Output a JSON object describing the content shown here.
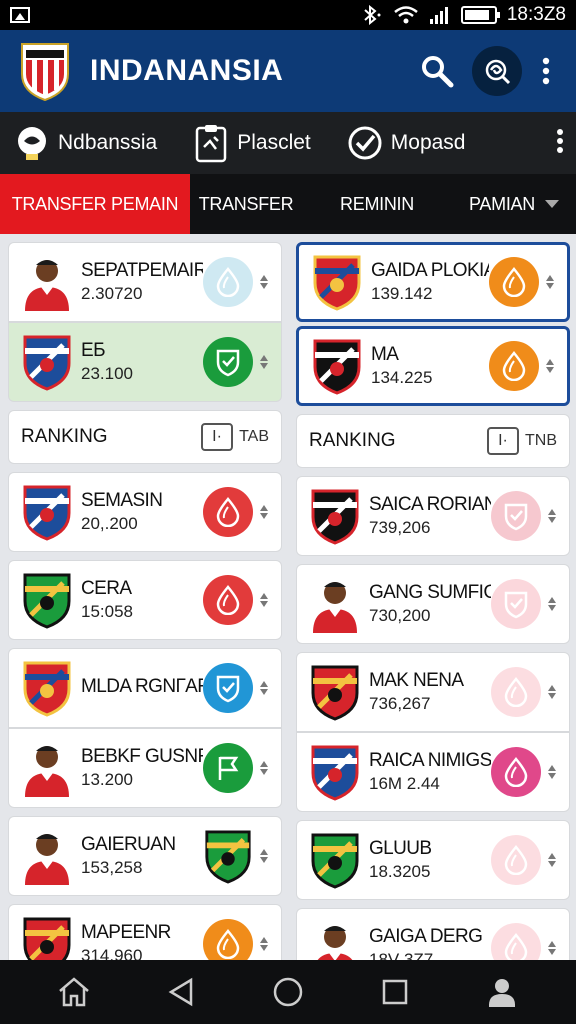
{
  "status_bar": {
    "time": "18:3Z8",
    "battery_level": 0.85
  },
  "header": {
    "title": "INDANANSIA"
  },
  "sub_nav": {
    "items": [
      {
        "label": "Ndbanssia",
        "icon": "badge-icon"
      },
      {
        "label": "Plasclet",
        "icon": "clipboard-icon"
      },
      {
        "label": "Mopasd",
        "icon": "check-circle-icon"
      }
    ]
  },
  "tabs": [
    {
      "label": "TRANSFER PEMAIN",
      "active": true
    },
    {
      "label": "TRANSFER"
    },
    {
      "label": "REMININ"
    },
    {
      "label": "PAMIAN"
    }
  ],
  "left_column": {
    "cards_top": [
      {
        "name": "SEPATPEMAIR",
        "value": "2.30720",
        "thumb": "player-photo",
        "badge_color": "#cfe9f2",
        "badge_icon": "drop-icon"
      },
      {
        "name": "EБ",
        "value": "23.100",
        "thumb": "club-crest",
        "badge_color": "#1a9c3c",
        "badge_icon": "shield-icon"
      }
    ],
    "ranking": {
      "label": "RANKING",
      "box": "I·",
      "tag": "TAB"
    },
    "cards_bottom": [
      {
        "name": "SEMASIN",
        "value": "20,.200",
        "thumb": "club-crest",
        "badge_color": "#e23b3b",
        "badge_icon": "drop-icon"
      },
      {
        "name": "CERA",
        "value": "15:058",
        "thumb": "club-crest",
        "badge_color": "#e23b3b",
        "badge_icon": "drop-icon"
      },
      {
        "name": "MLDA RGNГAR",
        "value": "",
        "thumb": "club-crest",
        "badge_color": "#2196d6",
        "badge_icon": "shield-icon"
      },
      {
        "name": "BEBKF GUSNR",
        "value": "13.200",
        "thumb": "player-photo",
        "badge_color": "#1a9c3c",
        "badge_icon": "flag-icon"
      },
      {
        "name": "GAIERUAN",
        "value": "153,258",
        "thumb": "player-photo",
        "badge_color": "none",
        "badge_icon": "club-crest"
      },
      {
        "name": "MAPEENR",
        "value": "314.960",
        "thumb": "club-crest",
        "badge_color": "#f08c1a",
        "badge_icon": "drop-icon"
      }
    ]
  },
  "right_column": {
    "cards_top": [
      {
        "name": "GAIDA PLOKIA",
        "value": "139.142",
        "thumb": "club-crest",
        "badge_color": "#f08c1a",
        "badge_icon": "drop-icon"
      },
      {
        "name": "MA",
        "value": "134.225",
        "thumb": "club-crest",
        "badge_color": "#f08c1a",
        "badge_icon": "drop-icon"
      }
    ],
    "ranking": {
      "label": "RANKING",
      "box": "I·",
      "tag": "TNB"
    },
    "cards_bottom": [
      {
        "name": "SAICA RORIAN",
        "value": "739,206",
        "thumb": "club-crest",
        "badge_color": "#f6c8cf",
        "badge_icon": "shield-icon"
      },
      {
        "name": "GANG SUMFIG",
        "value": "730,200",
        "thumb": "player-photo",
        "badge_color": "#fbd7dc",
        "badge_icon": "shield-icon"
      },
      {
        "name": "MAK NENA",
        "value": "736,267",
        "thumb": "club-crest",
        "badge_color": "#fcdde1",
        "badge_icon": "drop-icon"
      },
      {
        "name": "RAICA NIMIGS",
        "value": "16M 2.44",
        "thumb": "club-crest",
        "badge_color": "#e0488a",
        "badge_icon": "drop-icon"
      },
      {
        "name": "GLUUB",
        "value": "18.3205",
        "thumb": "club-crest",
        "badge_color": "#fcdde1",
        "badge_icon": "drop-icon"
      },
      {
        "name": "GAIGA DERG",
        "value": "18V 3Z7",
        "thumb": "player-photo",
        "badge_color": "#fcdde1",
        "badge_icon": "drop-icon"
      }
    ]
  },
  "nav_bar": {
    "items": [
      "home-icon",
      "back-icon",
      "circle-home-icon",
      "recents-icon",
      "profile-icon"
    ]
  }
}
